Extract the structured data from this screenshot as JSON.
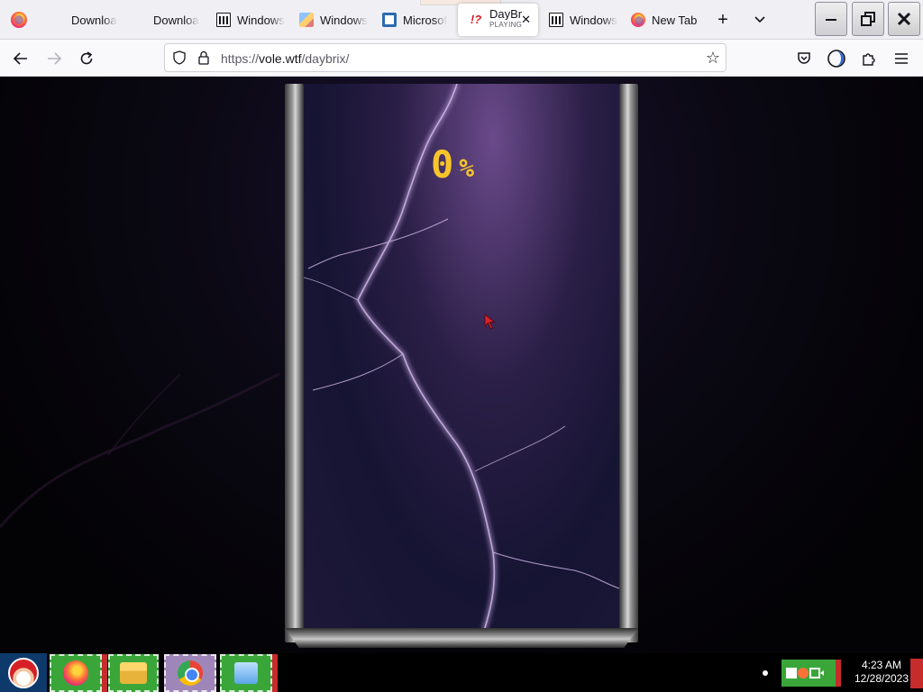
{
  "browser": {
    "tabs": [
      {
        "label": "Downloa",
        "icon": "microsoft-icon"
      },
      {
        "label": "Downloa",
        "icon": "microsoft-icon"
      },
      {
        "label": "Windows",
        "icon": "library-icon"
      },
      {
        "label": "Windows",
        "icon": "picture-icon"
      },
      {
        "label": "Microsof",
        "icon": "document-icon"
      },
      {
        "label": "DayBri",
        "sublabel": "PLAYING",
        "icon": "daybrix-icon",
        "active": true
      },
      {
        "label": "Windows",
        "icon": "library-icon"
      },
      {
        "label": "New Tab",
        "icon": "firefox-icon"
      }
    ],
    "new_tab_symbol": "+",
    "tab_list_symbol": "⌄",
    "window_controls": {
      "minimize": "—",
      "restore": "❐",
      "close": "✕"
    },
    "url_scheme": "https://",
    "url_host": "vole.wtf",
    "url_path": "/daybrix/",
    "accent": "#f7c52a"
  },
  "game": {
    "progress_value": "0",
    "progress_unit": "%",
    "progress_fraction": 0
  },
  "taskbar": {
    "apps": [
      "firefox",
      "file-explorer",
      "chrome",
      "app"
    ],
    "clock_time": "4:23 AM",
    "clock_date": "12/28/2023"
  }
}
